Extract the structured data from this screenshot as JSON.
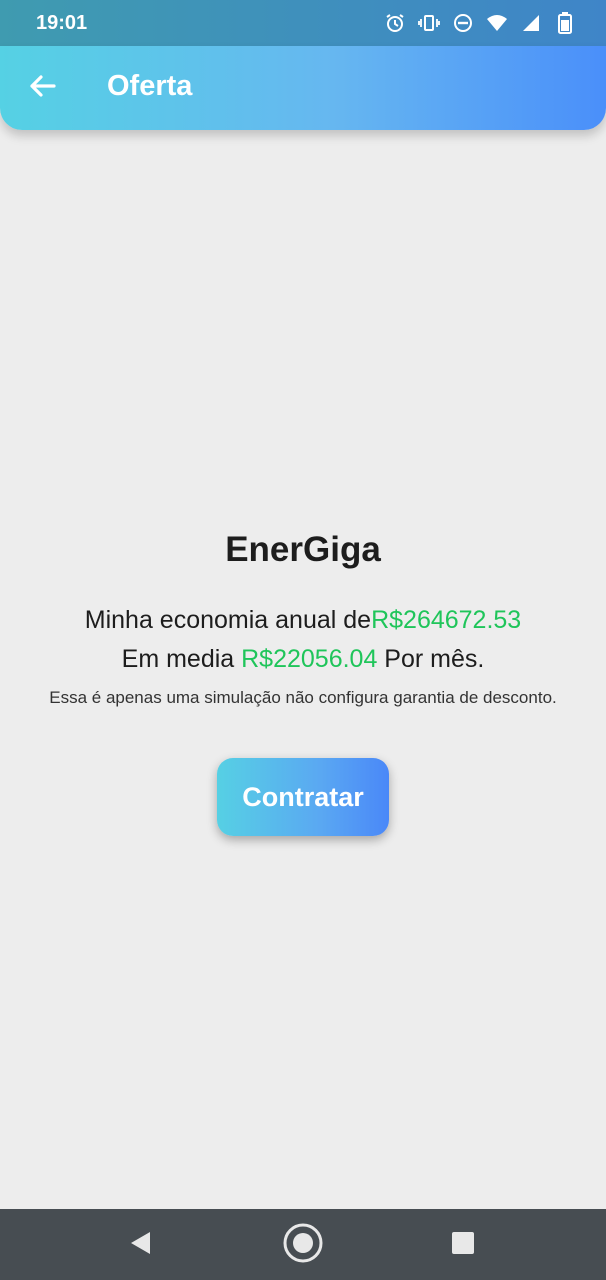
{
  "status_bar": {
    "time": "19:01",
    "icons": [
      "alarm-icon",
      "vibrate-icon",
      "do-not-disturb-icon",
      "wifi-icon",
      "signal-icon",
      "battery-icon"
    ]
  },
  "app_bar": {
    "title": "Oferta",
    "back_icon": "arrow-back-icon"
  },
  "offer": {
    "brand": "EnerGiga",
    "annual_prefix": "Minha economia anual de",
    "annual_value": "R$264672.53",
    "monthly_prefix": "Em media ",
    "monthly_value": "R$22056.04",
    "monthly_suffix": " Por mês.",
    "disclaimer": "Essa é apenas uma simulação não configura garantia de desconto.",
    "cta_label": "Contratar"
  },
  "nav_bar": {
    "icons": [
      "back-triangle-icon",
      "home-circle-icon",
      "recents-square-icon"
    ]
  },
  "colors": {
    "accent_green": "#1fc55a",
    "gradient_start": "#55d1e4",
    "gradient_end": "#4a8ffa",
    "background": "#ededed"
  }
}
